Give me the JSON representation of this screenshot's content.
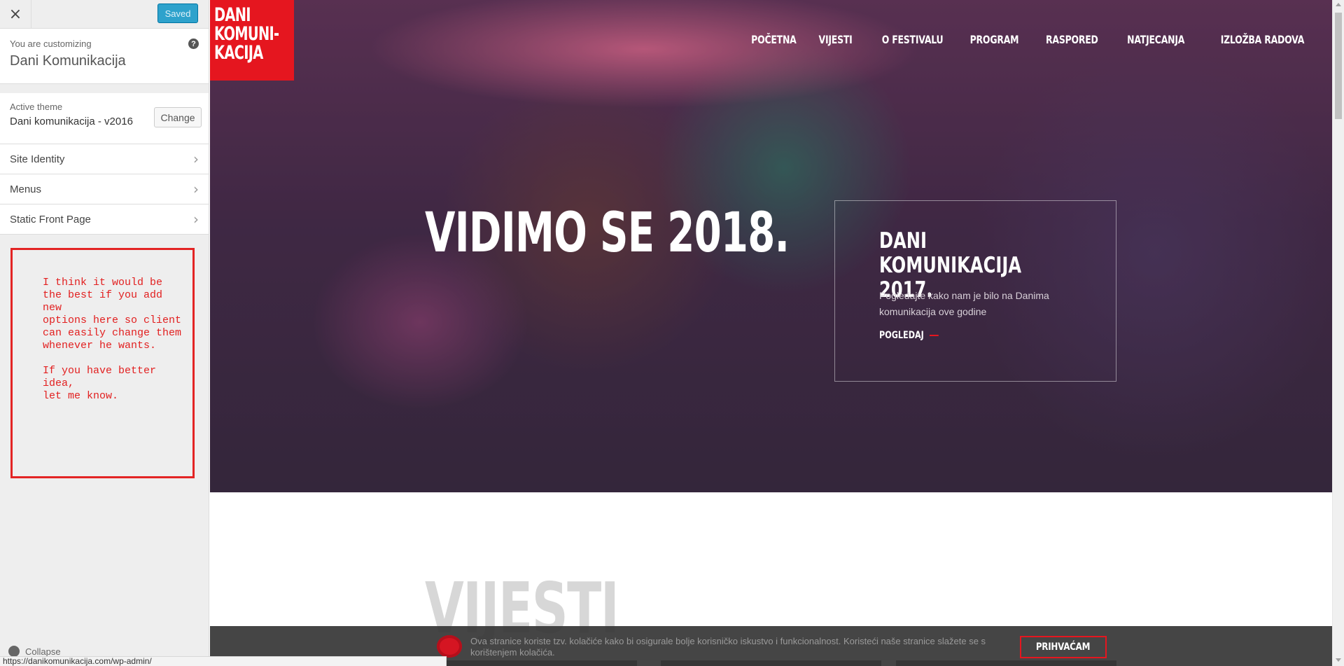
{
  "customizer": {
    "close_icon": "×",
    "saved_label": "Saved",
    "customizing_label": "You are customizing",
    "site_title": "Dani Komunikacija",
    "help_icon": "?",
    "active_theme_label": "Active theme",
    "active_theme_name": "Dani komunikacija - v2016",
    "change_label": "Change",
    "sections": [
      {
        "label": "Site Identity",
        "chevron": "›"
      },
      {
        "label": "Menus",
        "chevron": "›"
      },
      {
        "label": "Static Front Page",
        "chevron": "›"
      }
    ],
    "note": "I think it would be\nthe best if you add new\noptions here so client\ncan easily change them\nwhenever he wants.\n\nIf you have better idea,\nlet me know.",
    "collapse_label": "Collapse"
  },
  "status_bar": {
    "url": "https://danikomunikacija.com/wp-admin/"
  },
  "site": {
    "logo_lines": [
      "DANI",
      "KOMUNI-",
      "KACIJA"
    ],
    "nav": [
      "POČETNA",
      "VIJESTI",
      "O FESTIVALU",
      "PROGRAM",
      "RASPORED",
      "NATJECANJA",
      "IZLOŽBA RADOVA"
    ],
    "headline": "VIDIMO SE 2018.",
    "promo": {
      "title": "DANI KOMUNIKACIJA 2017.",
      "text": "Pogledajte kako nam je bilo na Danima komunikacija ove godine",
      "link": "POGLEDAJ"
    },
    "section_heading": "VIJESTI",
    "cookie": {
      "text": "Ova stranice koriste tzv. kolačiće kako bi osigurale bolje korisničko iskustvo i funkcionalnost. Koristeći naše stranice slažete se s korištenjem kolačića.",
      "accept": "PRIHVAĆAM"
    }
  },
  "colors": {
    "brand_red": "#e5161f",
    "saved_blue": "#2ea2cc",
    "note_red": "#e21f1f"
  }
}
